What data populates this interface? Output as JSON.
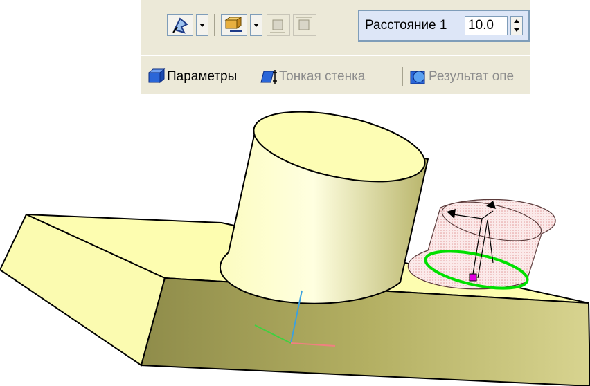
{
  "toolbar": {
    "distance_label": "Расстояние",
    "distance_hotkey": "1",
    "distance_value": "10.0"
  },
  "tabs": [
    {
      "label": "Параметры",
      "state": "active"
    },
    {
      "label": "Тонкая стенка",
      "state": "disabled"
    },
    {
      "label": "Результат опе",
      "state": "disabled"
    }
  ],
  "colors": {
    "panel_bg": "#ece9d8",
    "model_fill": "#ffff99",
    "highlight_green": "#00e000"
  }
}
